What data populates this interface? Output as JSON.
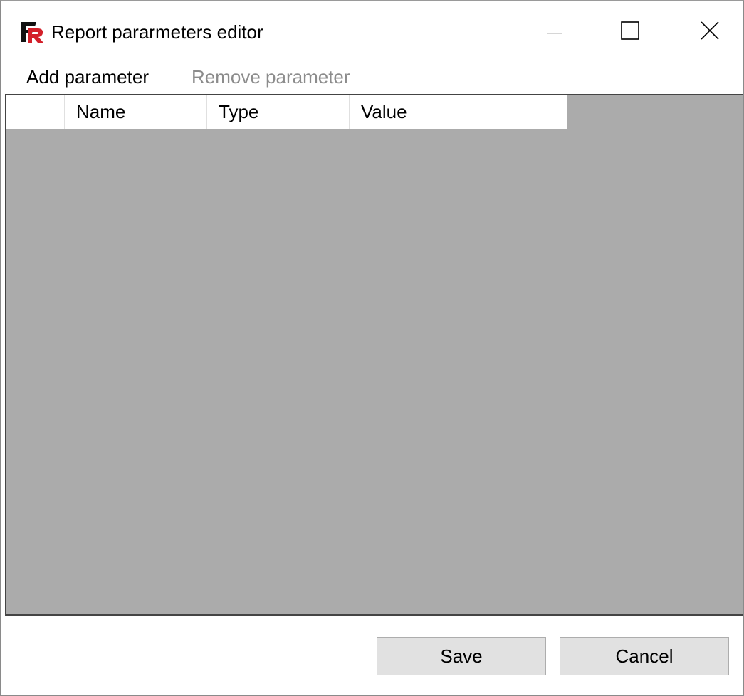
{
  "window": {
    "title": "Report pararmeters editor",
    "app_icon": "fastreport-logo-icon"
  },
  "title_controls": {
    "minimize_icon": "minimize-icon",
    "maximize_icon": "maximize-icon",
    "close_icon": "close-icon"
  },
  "menu": {
    "add_label": "Add parameter",
    "remove_label": "Remove parameter"
  },
  "grid": {
    "columns": [
      "Name",
      "Type",
      "Value"
    ],
    "rows": [],
    "background_color": "#ababab"
  },
  "footer": {
    "save_label": "Save",
    "cancel_label": "Cancel"
  }
}
